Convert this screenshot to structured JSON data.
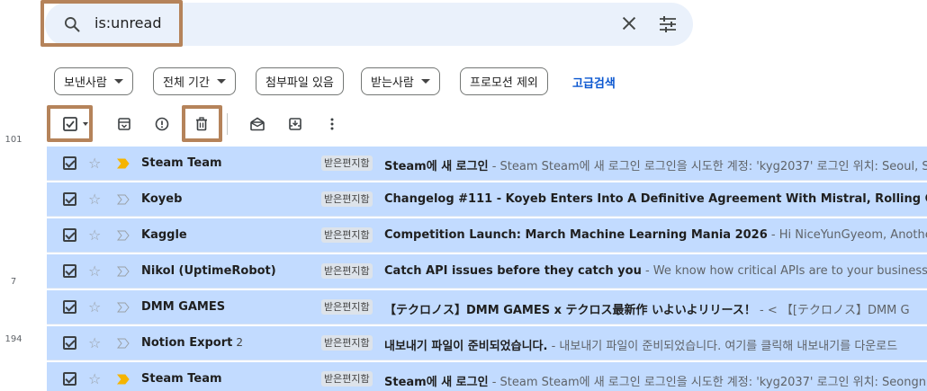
{
  "gutter": [
    "101",
    "7",
    "194"
  ],
  "search": {
    "query": "is:unread"
  },
  "filters": {
    "from": "보낸사람",
    "any_time": "전체 기간",
    "has_attachment": "첨부파일 있음",
    "to": "받는사람",
    "exclude_promotions": "프로모션 제외",
    "advanced": "고급검색"
  },
  "emails": [
    {
      "sender": "Steam Team",
      "count": "",
      "label": "받은편지함",
      "subject": "Steam에 새 로그인",
      "snippet": " - Steam Steam에 새 로그인 로그인을 시도한 계정: 'kyg2037' 로그인 위치: Seoul, S",
      "important": true
    },
    {
      "sender": "Koyeb",
      "count": "",
      "label": "받은편지함",
      "subject": "Changelog #111 - Koyeb Enters Into A Definitive Agreement With Mistral, Rolling Out Man",
      "snippet": "",
      "important": false
    },
    {
      "sender": "Kaggle",
      "count": "",
      "label": "받은편지함",
      "subject": "Competition Launch: March Machine Learning Mania 2026",
      "snippet": " - Hi NiceYunGyeom, Another yea",
      "important": false
    },
    {
      "sender": "Nikol (UptimeRobot)",
      "count": "",
      "label": "받은편지함",
      "subject": "Catch API issues before they catch you",
      "snippet": " - We know how critical APIs are to your business, and",
      "important": false
    },
    {
      "sender": "DMM GAMES",
      "count": "",
      "label": "받은편지함",
      "subject": "【テクロノス】DMM GAMES x テクロス最新作 いよいよリリース！",
      "snippet": " - < 【[テクロノス】DMM G",
      "important": false
    },
    {
      "sender": "Notion Export",
      "count": "2",
      "label": "받은편지함",
      "subject": "내보내기 파일이 준비되었습니다.",
      "snippet": " - 내보내기 파일이 준비되었습니다. 여기를 클릭해 내보내기를 다운로드",
      "important": false
    },
    {
      "sender": "Steam Team",
      "count": "",
      "label": "받은편지함",
      "subject": "Steam에 새 로그인",
      "snippet": " - Steam Steam에 새 로그인 로그인을 시도한 계정: 'kyg2037' 로그인 위치: Seongn",
      "important": true
    }
  ],
  "colors": {
    "highlight": "#b5835a",
    "selected_row": "#c2dbff",
    "important": "#f5b400",
    "link": "#0b57d0"
  }
}
